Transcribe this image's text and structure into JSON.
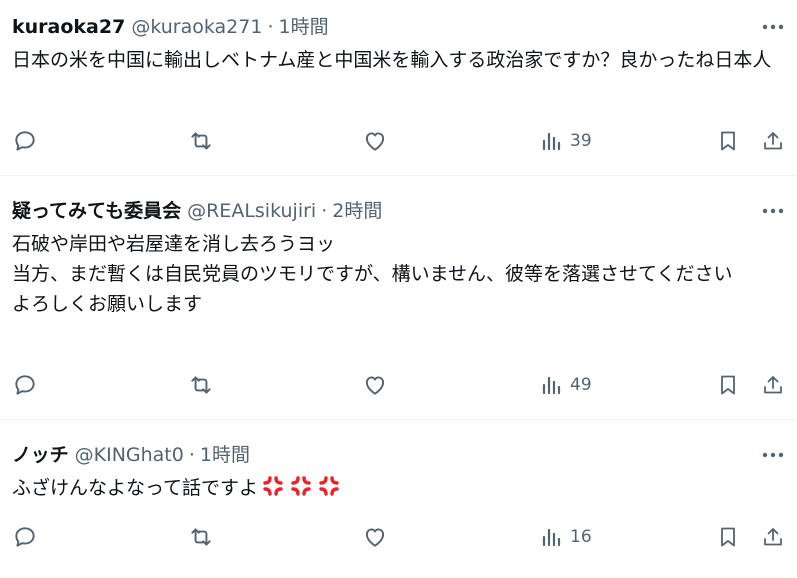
{
  "colors": {
    "text": "#0f1419",
    "secondary": "#536471",
    "divider": "#eff3f4",
    "anger_emoji": "#e8232a"
  },
  "posts": [
    {
      "author_name": "kuraoka27",
      "handle": "@kuraoka271",
      "separator": "·",
      "time": "1時間",
      "text": "日本の米を中国に輸出しベトナム産と中国米を輸入する政治家ですか？良かったね日本人",
      "views": "39",
      "icons": [
        "reply-icon",
        "retweet-icon",
        "like-icon",
        "views-icon",
        "bookmark-icon",
        "share-icon",
        "more-icon"
      ]
    },
    {
      "author_name": "疑ってみても委員会",
      "handle": "@REALsikujiri",
      "separator": "·",
      "time": "2時間",
      "text": "石破や岸田や岩屋達を消し去ろうヨッ\n当方、まだ暫くは自民党員のツモリですが、構いません、彼等を落選させてください\nよろしくお願いします",
      "views": "49",
      "icons": [
        "reply-icon",
        "retweet-icon",
        "like-icon",
        "views-icon",
        "bookmark-icon",
        "share-icon",
        "more-icon"
      ]
    },
    {
      "author_name": "ノッチ",
      "handle": "@KINGhat0",
      "separator": "·",
      "time": "1時間",
      "text": "ふざけんなよなって話ですよ",
      "emoji": [
        "anger-symbol",
        "anger-symbol",
        "anger-symbol"
      ],
      "views": "16",
      "icons": [
        "reply-icon",
        "retweet-icon",
        "like-icon",
        "views-icon",
        "bookmark-icon",
        "share-icon",
        "more-icon"
      ]
    }
  ]
}
